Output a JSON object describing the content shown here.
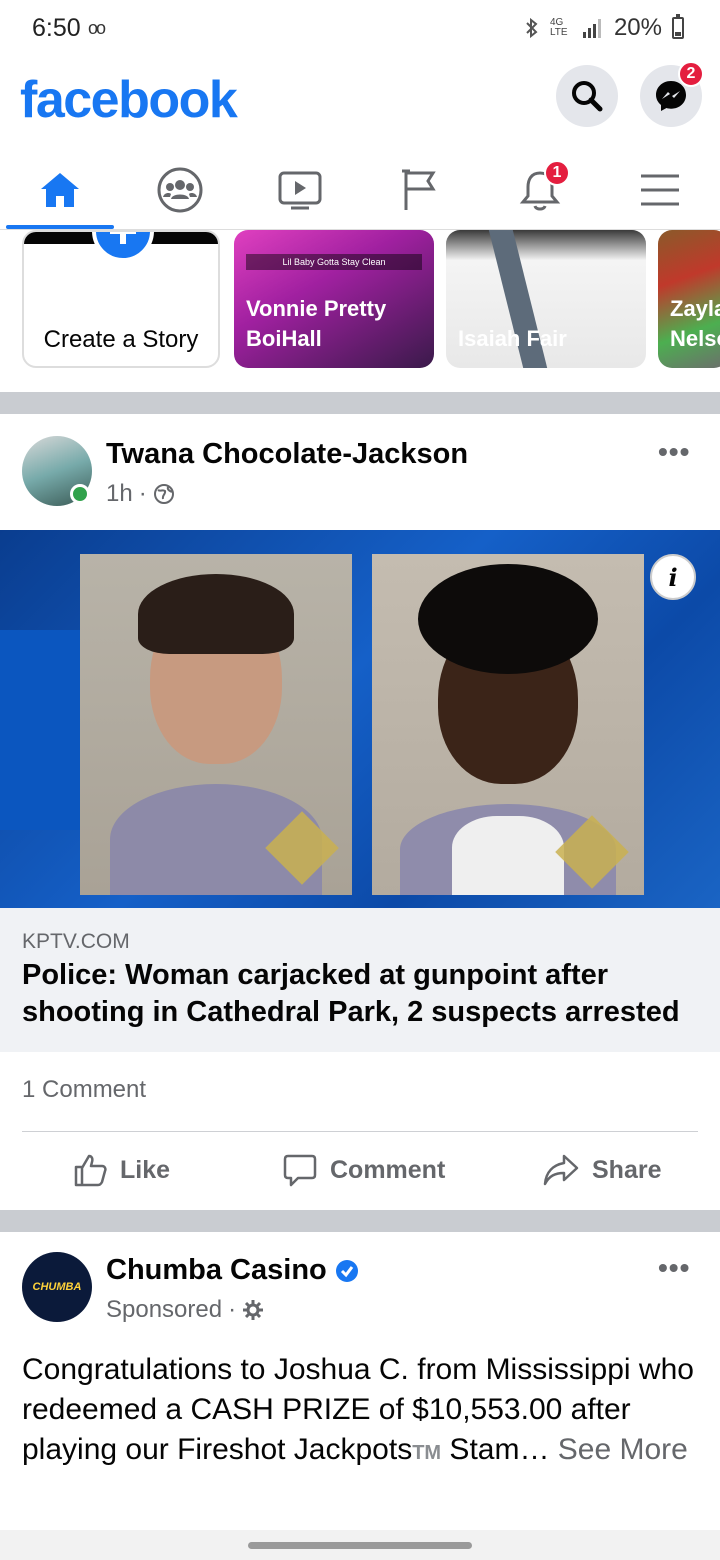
{
  "status": {
    "time": "6:50",
    "voicemail_icon": "voicemail-icon",
    "battery": "20%",
    "network": "4G LTE"
  },
  "header": {
    "logo": "facebook",
    "messenger_badge": "2"
  },
  "nav": {
    "notifications_badge": "1"
  },
  "stories": [
    {
      "name": "Create a Story"
    },
    {
      "name": "Vonnie Pretty BoiHall",
      "caption": "Lil Baby Gotta Stay Clean"
    },
    {
      "name": "Isaiah Fair"
    },
    {
      "name": "Zayla Nelso"
    }
  ],
  "post": {
    "author": "Twana Chocolate-Jackson",
    "time": "1h",
    "privacy_icon": "globe-icon",
    "link_domain": "KPTV.COM",
    "link_title": "Police: Woman carjacked at gunpoint after shooting in Cathedral Park, 2 suspects arrested",
    "comments": "1 Comment",
    "actions": {
      "like": "Like",
      "comment": "Comment",
      "share": "Share"
    }
  },
  "ad": {
    "author": "Chumba Casino",
    "sponsored": "Sponsored",
    "logo_text": "CHUMBA",
    "text": "Congratulations to Joshua C. from Mississippi who redeemed a CASH PRIZE of $10,553.00 after playing our Fireshot Jackpots",
    "tm": "TM",
    "text_tail": " Stam…",
    "see_more": "See More"
  },
  "colors": {
    "accent": "#1877f2",
    "badge": "#e41e3f",
    "online": "#31a24c",
    "separator": "#c9ccd1"
  }
}
